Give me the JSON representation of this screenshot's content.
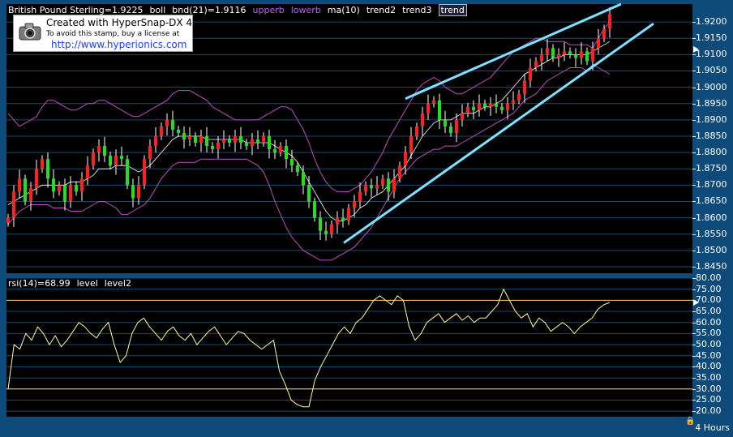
{
  "header": {
    "symbol": "British Pound Sterling=1.9225",
    "boll": "boll",
    "bnd": "bnd(21)=1.9116",
    "upperb": "upperb",
    "lowerb": "lowerb",
    "ma": "ma(10)",
    "trend2": "trend2",
    "trend3": "trend3",
    "trend": "trend"
  },
  "rsi_header": {
    "rsi": "rsi(14)=68.99",
    "level": "level",
    "level2": "level2"
  },
  "stamp": {
    "line1": "Created with HyperSnap-DX 4",
    "line2": "To avoid this stamp, buy a license at",
    "line3": "http://www.hyperionics.com"
  },
  "footer": {
    "timeframe": "4 Hours",
    "lock_icon": "lock-icon"
  },
  "colors": {
    "up": "#ff2020",
    "down": "#20e020",
    "band": "#c050c0",
    "ma": "#ffffff",
    "trend": "#7fe0ff",
    "rsi": "#ffff99",
    "level": "#ffcc66"
  },
  "chart_data": [
    {
      "type": "candlestick",
      "title": "",
      "ylim": [
        1.843,
        1.9255
      ],
      "yticks": [
        "1.9200",
        "1.9150",
        "1.9100",
        "1.9050",
        "1.9000",
        "1.8950",
        "1.8900",
        "1.8850",
        "1.8800",
        "1.8750",
        "1.8700",
        "1.8650",
        "1.8600",
        "1.8550",
        "1.8500",
        "1.8450"
      ],
      "ytick_values": [
        1.92,
        1.915,
        1.91,
        1.905,
        1.9,
        1.895,
        1.89,
        1.885,
        1.88,
        1.875,
        1.87,
        1.865,
        1.86,
        1.855,
        1.85,
        1.845
      ],
      "last_marker": 1.9116,
      "close": [
        1.86,
        1.868,
        1.872,
        1.865,
        1.869,
        1.875,
        1.878,
        1.872,
        1.868,
        1.87,
        1.865,
        1.87,
        1.868,
        1.872,
        1.876,
        1.88,
        1.882,
        1.879,
        1.876,
        1.879,
        1.878,
        1.87,
        1.866,
        1.87,
        1.878,
        1.882,
        1.885,
        1.888,
        1.89,
        1.887,
        1.886,
        1.884,
        1.885,
        1.883,
        1.885,
        1.882,
        1.881,
        1.883,
        1.884,
        1.883,
        1.885,
        1.883,
        1.882,
        1.884,
        1.883,
        1.885,
        1.881,
        1.88,
        1.882,
        1.878,
        1.876,
        1.874,
        1.87,
        1.865,
        1.86,
        1.856,
        1.855,
        1.858,
        1.86,
        1.859,
        1.863,
        1.865,
        1.868,
        1.87,
        1.869,
        1.87,
        1.872,
        1.868,
        1.872,
        1.876,
        1.88,
        1.885,
        1.888,
        1.892,
        1.895,
        1.896,
        1.89,
        1.888,
        1.886,
        1.89,
        1.892,
        1.894,
        1.893,
        1.895,
        1.894,
        1.895,
        1.894,
        1.893,
        1.895,
        1.896,
        1.898,
        1.902,
        1.906,
        1.908,
        1.91,
        1.912,
        1.909,
        1.91,
        1.911,
        1.91,
        1.909,
        1.911,
        1.908,
        1.912,
        1.915,
        1.918,
        1.9225
      ],
      "upper_band": [
        1.892,
        1.89,
        1.888,
        1.889,
        1.89,
        1.891,
        1.894,
        1.896,
        1.896,
        1.895,
        1.894,
        1.893,
        1.893,
        1.894,
        1.895,
        1.895,
        1.896,
        1.896,
        1.895,
        1.894,
        1.893,
        1.892,
        1.891,
        1.891,
        1.892,
        1.893,
        1.894,
        1.895,
        1.896,
        1.898,
        1.899,
        1.899,
        1.899,
        1.898,
        1.897,
        1.896,
        1.894,
        1.893,
        1.892,
        1.891,
        1.89,
        1.89,
        1.89,
        1.89,
        1.89,
        1.891,
        1.892,
        1.893,
        1.894,
        1.894,
        1.893,
        1.89,
        1.887,
        1.883,
        1.878,
        1.874,
        1.871,
        1.869,
        1.868,
        1.868,
        1.868,
        1.869,
        1.87,
        1.872,
        1.874,
        1.877,
        1.88,
        1.884,
        1.887,
        1.89,
        1.893,
        1.896,
        1.899,
        1.901,
        1.902,
        1.903,
        1.902,
        1.9,
        1.899,
        1.898,
        1.898,
        1.899,
        1.9,
        1.901,
        1.902,
        1.903,
        1.905,
        1.907,
        1.909,
        1.911,
        1.912,
        1.913,
        1.914,
        1.915,
        1.915,
        1.914,
        1.914,
        1.914,
        1.914,
        1.913,
        1.913,
        1.913,
        1.913,
        1.912,
        1.915,
        1.918,
        1.92
      ],
      "lower_band": [
        1.858,
        1.86,
        1.862,
        1.863,
        1.864,
        1.864,
        1.864,
        1.864,
        1.863,
        1.863,
        1.863,
        1.862,
        1.862,
        1.862,
        1.863,
        1.864,
        1.865,
        1.865,
        1.864,
        1.863,
        1.861,
        1.861,
        1.862,
        1.863,
        1.864,
        1.866,
        1.869,
        1.872,
        1.874,
        1.876,
        1.877,
        1.877,
        1.877,
        1.877,
        1.878,
        1.878,
        1.878,
        1.878,
        1.878,
        1.878,
        1.878,
        1.878,
        1.878,
        1.877,
        1.876,
        1.874,
        1.87,
        1.865,
        1.861,
        1.857,
        1.854,
        1.852,
        1.85,
        1.849,
        1.848,
        1.847,
        1.847,
        1.847,
        1.848,
        1.849,
        1.85,
        1.851,
        1.853,
        1.855,
        1.857,
        1.86,
        1.863,
        1.866,
        1.869,
        1.872,
        1.874,
        1.876,
        1.878,
        1.879,
        1.88,
        1.881,
        1.881,
        1.882,
        1.882,
        1.882,
        1.883,
        1.884,
        1.885,
        1.886,
        1.887,
        1.888,
        1.889,
        1.89,
        1.891,
        1.892,
        1.894,
        1.896,
        1.897,
        1.898,
        1.9,
        1.902,
        1.903,
        1.904,
        1.905,
        1.906,
        1.906,
        1.906,
        1.905,
        1.907,
        1.906,
        1.905,
        1.904
      ],
      "ma_10": [
        1.864,
        1.865,
        1.866,
        1.867,
        1.868,
        1.869,
        1.87,
        1.87,
        1.87,
        1.87,
        1.87,
        1.871,
        1.871,
        1.871,
        1.872,
        1.873,
        1.875,
        1.875,
        1.875,
        1.876,
        1.876,
        1.876,
        1.875,
        1.874,
        1.875,
        1.876,
        1.878,
        1.88,
        1.882,
        1.884,
        1.885,
        1.885,
        1.885,
        1.885,
        1.885,
        1.884,
        1.884,
        1.884,
        1.884,
        1.884,
        1.884,
        1.884,
        1.883,
        1.883,
        1.883,
        1.883,
        1.883,
        1.882,
        1.881,
        1.88,
        1.879,
        1.877,
        1.874,
        1.871,
        1.868,
        1.865,
        1.862,
        1.86,
        1.859,
        1.859,
        1.86,
        1.861,
        1.863,
        1.864,
        1.866,
        1.867,
        1.868,
        1.87,
        1.872,
        1.874,
        1.876,
        1.879,
        1.882,
        1.885,
        1.887,
        1.889,
        1.89,
        1.89,
        1.89,
        1.891,
        1.892,
        1.892,
        1.892,
        1.893,
        1.894,
        1.894,
        1.895,
        1.896,
        1.898,
        1.9,
        1.902,
        1.904,
        1.905,
        1.906,
        1.907,
        1.908,
        1.909,
        1.909,
        1.91,
        1.91,
        1.91,
        1.91,
        1.91,
        1.911,
        1.912,
        1.913,
        1.914
      ]
    },
    {
      "type": "line",
      "title": "",
      "ylim": [
        17.5,
        80
      ],
      "yticks": [
        "80.00",
        "75.00",
        "70.00",
        "65.00",
        "60.00",
        "55.00",
        "50.00",
        "45.00",
        "40.00",
        "35.00",
        "30.00",
        "25.00",
        "20.00"
      ],
      "ytick_values": [
        80,
        75,
        70,
        65,
        60,
        55,
        50,
        45,
        40,
        35,
        30,
        25,
        20
      ],
      "last_marker": 68.99,
      "levels": [
        70,
        30
      ],
      "rsi": [
        30,
        50,
        48,
        55,
        52,
        58,
        55,
        50,
        54,
        49,
        52,
        56,
        60,
        58,
        55,
        53,
        57,
        60,
        50,
        42,
        45,
        55,
        60,
        62,
        58,
        55,
        52,
        56,
        58,
        54,
        52,
        55,
        50,
        53,
        56,
        58,
        54,
        50,
        53,
        56,
        55,
        52,
        50,
        48,
        50,
        52,
        38,
        32,
        25,
        23,
        22,
        22,
        34,
        40,
        45,
        50,
        55,
        58,
        55,
        60,
        62,
        66,
        70,
        72,
        70,
        68,
        72,
        70,
        58,
        52,
        55,
        60,
        62,
        64,
        60,
        62,
        64,
        61,
        63,
        60,
        62,
        62,
        65,
        68,
        75,
        70,
        65,
        62,
        64,
        58,
        62,
        60,
        56,
        58,
        60,
        58,
        55,
        58,
        60,
        62,
        66,
        68,
        69
      ]
    }
  ]
}
